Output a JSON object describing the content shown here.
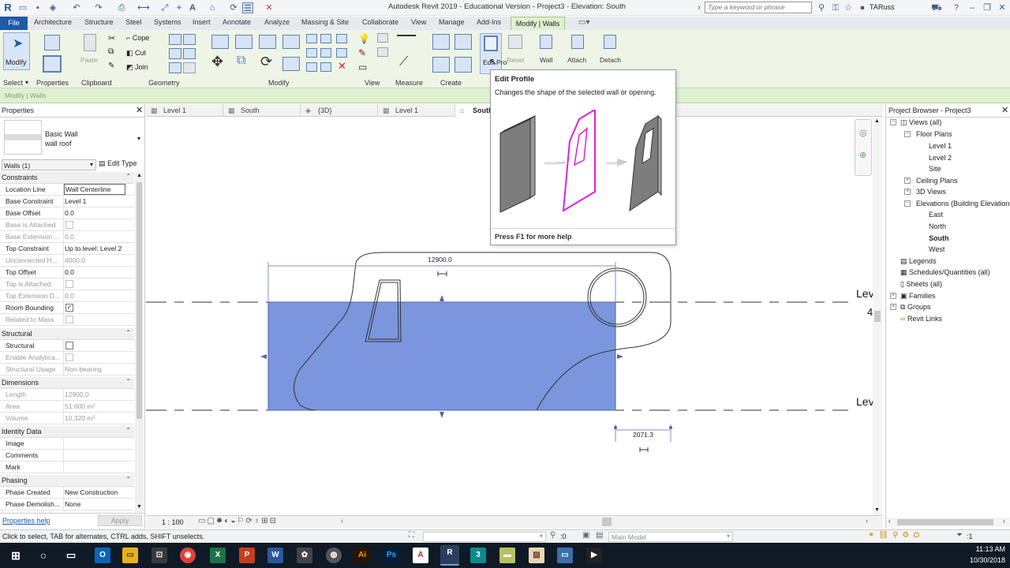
{
  "window": {
    "title": "Autodesk Revit 2019 - Educational Version - Project3 - Elevation: South",
    "search_placeholder": "Type a keyword or phrase",
    "user": "TARuss"
  },
  "tabs": [
    "File",
    "Architecture",
    "Structure",
    "Steel",
    "Systems",
    "Insert",
    "Annotate",
    "Analyze",
    "Massing & Site",
    "Collaborate",
    "View",
    "Manage",
    "Add-Ins",
    "Modify | Walls"
  ],
  "ribbon": {
    "groups": [
      "Select",
      "Properties",
      "Clipboard",
      "Geometry",
      "Modify",
      "View",
      "Measure",
      "Create"
    ],
    "modify_label": "Modify",
    "paste_label": "Paste",
    "cope_label": "Cope",
    "cut_label": "Cut",
    "join_label": "Join",
    "edit_profile_label": "Edit Pro",
    "reset_profile_label": "Reset",
    "wall_opening_label": "Wall",
    "attach_label": "Attach",
    "detach_label": "Detach",
    "context_label": "Modify | Walls"
  },
  "tooltip": {
    "title": "Edit Profile",
    "description": "Changes the shape of the selected wall or opening.",
    "footer": "Press F1 for more help"
  },
  "properties": {
    "title": "Properties",
    "type_family": "Basic Wall",
    "type_name": "wall roof",
    "selector": "Walls (1)",
    "edit_type": "Edit Type",
    "help_link": "Properties help",
    "apply": "Apply",
    "groups": {
      "constraints": "Constraints",
      "structural": "Structural",
      "dimensions": "Dimensions",
      "identity": "Identity Data",
      "phasing": "Phasing"
    },
    "rows": {
      "location_line": [
        "Location Line",
        "Wall Centerline"
      ],
      "base_constraint": [
        "Base Constraint",
        "Level 1"
      ],
      "base_offset": [
        "Base Offset",
        "0.0"
      ],
      "base_attached": [
        "Base is Attached",
        ""
      ],
      "base_extension": [
        "Base Extension ...",
        "0.0"
      ],
      "top_constraint": [
        "Top Constraint",
        "Up to level: Level 2"
      ],
      "unconnected": [
        "Unconnected H...",
        "4000.0"
      ],
      "top_offset": [
        "Top Offset",
        "0.0"
      ],
      "top_attached": [
        "Top is Attached",
        ""
      ],
      "top_extension": [
        "Top Extension D...",
        "0.0"
      ],
      "room_bounding": [
        "Room Bounding",
        "✓"
      ],
      "related_mass": [
        "Related to Mass",
        ""
      ],
      "structural": [
        "Structural",
        ""
      ],
      "enable_analytical": [
        "Enable Analytica...",
        ""
      ],
      "structural_usage": [
        "Structural Usage",
        "Non-bearing"
      ],
      "length": [
        "Length",
        "12900.0"
      ],
      "area": [
        "Area",
        "51.600 m²"
      ],
      "volume": [
        "Volume",
        "10.320 m³"
      ],
      "image": [
        "Image",
        ""
      ],
      "comments": [
        "Comments",
        ""
      ],
      "mark": [
        "Mark",
        ""
      ],
      "phase_created": [
        "Phase Created",
        "New Construction"
      ],
      "phase_demolished": [
        "Phase Demolish...",
        "None"
      ]
    }
  },
  "view_tabs": [
    "Level 1",
    "South",
    "{3D}",
    "Level 1",
    "South"
  ],
  "canvas": {
    "dim_top": "12900.0",
    "dim_bottom": "2071.3",
    "level_label_1": "Lev",
    "level_num_1": "4",
    "level_label_2": "Lev",
    "wall_fill": "#7b96dc"
  },
  "viewbar": {
    "scale": "1 : 100"
  },
  "browser": {
    "title": "Project Browser - Project3",
    "items": [
      "Views (all)",
      "Floor Plans",
      "Level 1",
      "Level 2",
      "Site",
      "Ceiling Plans",
      "3D Views",
      "Elevations (Building Elevation",
      "East",
      "North",
      "South",
      "West",
      "Legends",
      "Schedules/Quantities (all)",
      "Sheets (all)",
      "Families",
      "Groups",
      "Revit Links"
    ]
  },
  "status": {
    "hint": "Click to select, TAB for alternates, CTRL adds, SHIFT unselects.",
    "workset": ":0",
    "model": "Main Model",
    "filter": ":1"
  },
  "taskbar": {
    "time": "11:13 AM",
    "date": "10/30/2018"
  },
  "colors": {
    "accent": "#1e5aa8",
    "ribbon_context": "#dff0cf",
    "selection": "#7b96dc",
    "taskbar": "#0f1a26"
  }
}
